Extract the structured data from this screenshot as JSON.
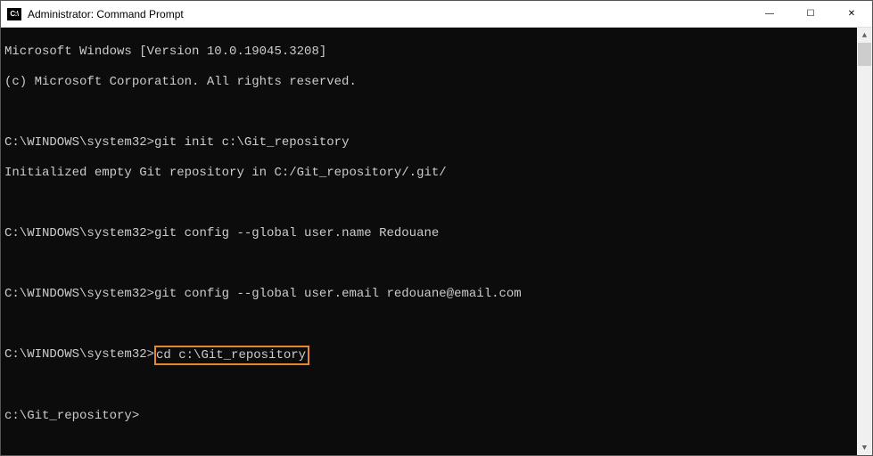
{
  "titlebar": {
    "icon_text": "C:\\",
    "title": "Administrator: Command Prompt",
    "minimize_symbol": "—",
    "maximize_symbol": "☐",
    "close_symbol": "✕"
  },
  "console": {
    "line1": "Microsoft Windows [Version 10.0.19045.3208]",
    "line2": "(c) Microsoft Corporation. All rights reserved.",
    "prompt1": "C:\\WINDOWS\\system32>",
    "cmd1": "git init c:\\Git_repository",
    "output1": "Initialized empty Git repository in C:/Git_repository/.git/",
    "prompt2": "C:\\WINDOWS\\system32>",
    "cmd2": "git config --global user.name Redouane",
    "prompt3": "C:\\WINDOWS\\system32>",
    "cmd3": "git config --global user.email redouane@email.com",
    "prompt4": "C:\\WINDOWS\\system32>",
    "cmd4": "cd c:\\Git_repository",
    "prompt5": "c:\\Git_repository>"
  },
  "highlight": {
    "command": "cd c:\\Git_repository",
    "color": "#e6892e"
  },
  "scrollbar": {
    "up": "▲",
    "down": "▼"
  }
}
